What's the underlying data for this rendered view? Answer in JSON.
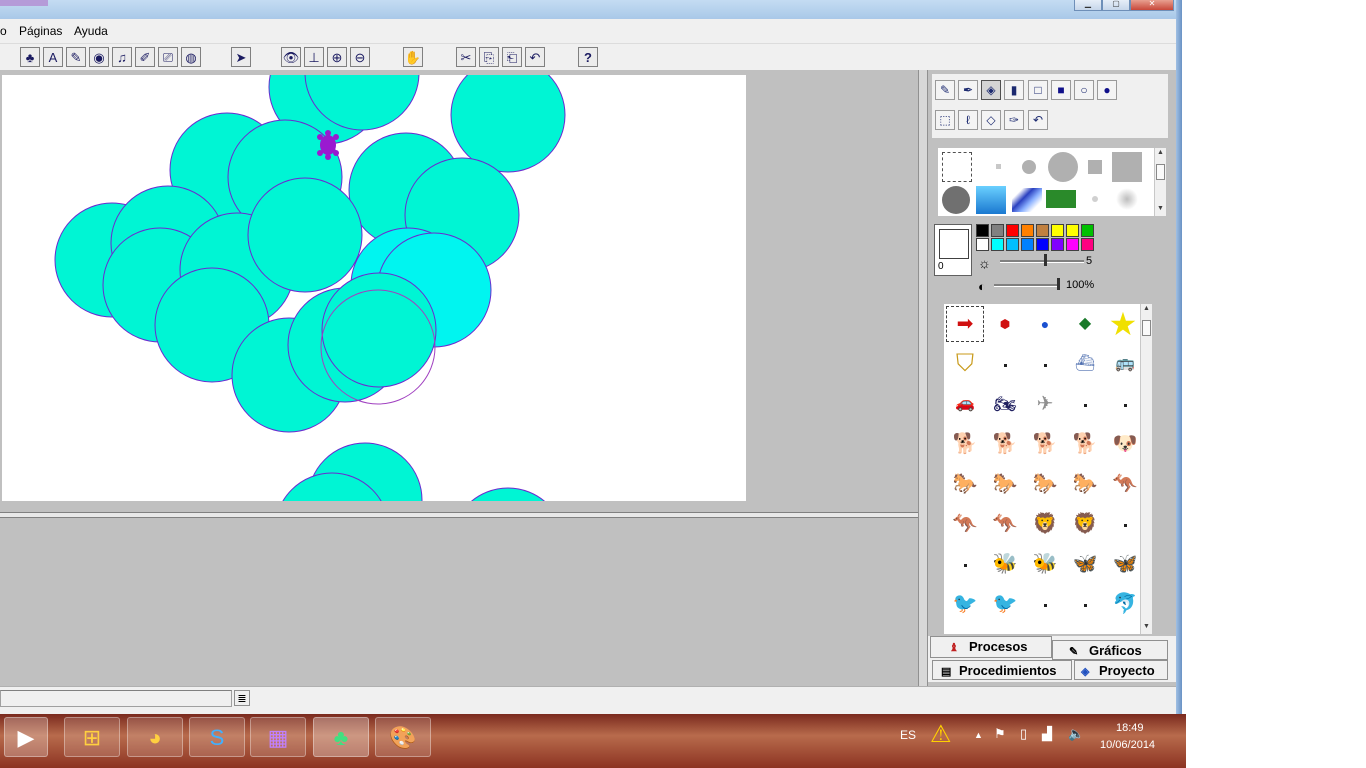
{
  "menu": {
    "items": [
      "o",
      "Páginas",
      "Ayuda"
    ]
  },
  "toolbar": {
    "help_label": "?"
  },
  "canvas": {
    "circle_fill": "#00f5d4",
    "circle_fill_alt": "#00f5f0",
    "circle_stroke": "#6a2ad0",
    "turtle_color": "#9a1ad0"
  },
  "right_panel": {
    "color_index": "0",
    "palette_colors": [
      "#000000",
      "#808080",
      "#ff0000",
      "#ff8000",
      "#c08040",
      "#ffff00",
      "#ffff00",
      "#00c000",
      "#ffffff",
      "#00ffff",
      "#00c0ff",
      "#0080ff",
      "#0000ff",
      "#8000ff",
      "#ff00ff",
      "#ff0080"
    ],
    "size_value": "5",
    "opacity_value": "100%"
  },
  "tabs": {
    "procesos": "Procesos",
    "graficos": "Gráficos",
    "procedimientos": "Procedimientos",
    "proyecto": "Proyecto"
  },
  "taskbar": {
    "language": "ES",
    "time": "18:49",
    "date": "10/06/2014"
  }
}
